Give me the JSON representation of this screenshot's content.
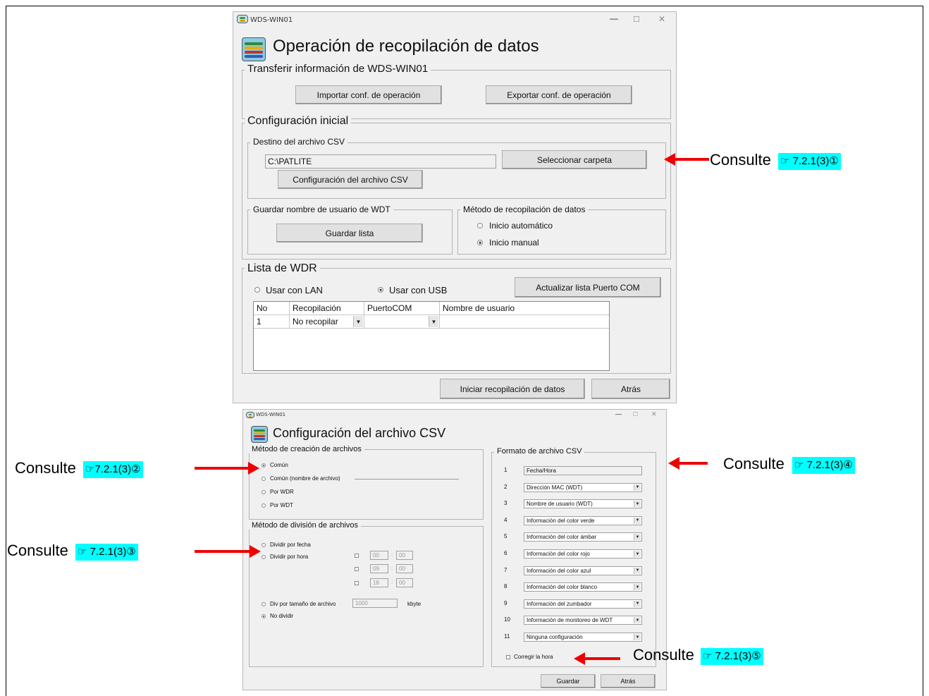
{
  "window1": {
    "titlebar": "WDS-WIN01",
    "title": "Operación de recopilación de datos",
    "transfer_group": "Transferir información de WDS-WIN01",
    "import_btn": "Importar conf. de operación",
    "export_btn": "Exportar conf. de operación",
    "initial_group": "Configuración inicial",
    "csv_dest_group": "Destino del archivo CSV",
    "csv_path": "C:\\PATLITE",
    "select_folder_btn": "Seleccionar carpeta",
    "csv_config_btn": "Configuración del archivo CSV",
    "save_user_group": "Guardar nombre de usuario de WDT",
    "save_list_btn": "Guardar lista",
    "method_group": "Método de recopilación de datos",
    "auto_start": "Inicio automático",
    "manual_start": "Inicio manual",
    "wdr_group": "Lista de WDR",
    "use_lan": "Usar con LAN",
    "use_usb": "Usar con USB",
    "update_com_btn": "Actualizar lista Puerto COM",
    "table": {
      "headers": [
        "No",
        "Recopilación",
        "PuertoCOM",
        "Nombre de usuario"
      ],
      "rows": [
        {
          "no": "1",
          "collect": "No recopilar",
          "port": "",
          "user": ""
        }
      ]
    },
    "start_btn": "Iniciar recopilación de datos",
    "back_btn": "Atrás"
  },
  "window2": {
    "titlebar": "WDS-WIN01",
    "title": "Configuración del archivo CSV",
    "creation_group": "Método de creación de archivos",
    "creation_options": [
      "Común",
      "Común (nombre de archivo)",
      "Por WDR",
      "Por WDT"
    ],
    "division_group": "Método de división de archivos",
    "divide_by_date": "Dividir por fecha",
    "divide_by_hour": "Dividir por hora",
    "hours": [
      {
        "h": "00",
        "m": "00"
      },
      {
        "h": "09",
        "m": "00"
      },
      {
        "h": "18",
        "m": "00"
      }
    ],
    "divide_by_size": "Div por tamaño de archivo",
    "size_value": "1000",
    "size_unit": "kbyte",
    "no_divide": "No dividir",
    "format_group": "Formato de archivo CSV",
    "format_rows": [
      {
        "n": "1",
        "v": "Fecha/Hora"
      },
      {
        "n": "2",
        "v": "Dirección MAC (WDT)"
      },
      {
        "n": "3",
        "v": "Nombre de usuario (WDT)"
      },
      {
        "n": "4",
        "v": "Información del color verde"
      },
      {
        "n": "5",
        "v": "Información del color ámbar"
      },
      {
        "n": "6",
        "v": "Información del color rojo"
      },
      {
        "n": "7",
        "v": "Información del color azul"
      },
      {
        "n": "8",
        "v": "Información del color blanco"
      },
      {
        "n": "9",
        "v": "Información del zumbador"
      },
      {
        "n": "10",
        "v": "Información de monitoreo de WDT"
      },
      {
        "n": "11",
        "v": "Ninguna configuración"
      }
    ],
    "correct_time": "Corregir la hora",
    "save_btn": "Guardar",
    "back_btn": "Atrás"
  },
  "callouts": {
    "word": "Consulte",
    "ref1": "☞ 7.2.1(3)①",
    "ref2": "☞7.2.1(3)②",
    "ref3": "☞ 7.2.1(3)③",
    "ref4": "☞ 7.2.1(3)④",
    "ref5": "☞ 7.2.1(3)⑤"
  },
  "colors": {
    "highlight": "#00ffff",
    "arrow": "#ee0000",
    "window_bg": "#f0f0f0"
  }
}
